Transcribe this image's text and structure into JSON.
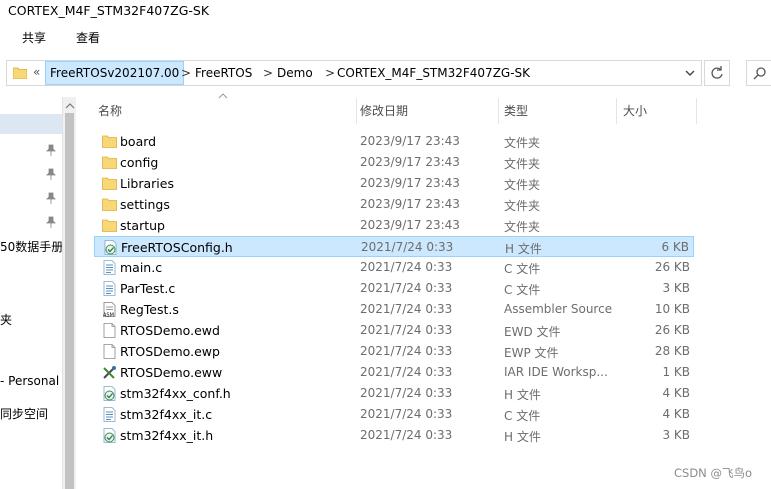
{
  "window": {
    "title": "CORTEX_M4F_STM32F407ZG-SK"
  },
  "ribbon": {
    "tabs": [
      "共享",
      "查看"
    ]
  },
  "address": {
    "overflow": "«",
    "crumbs": [
      "FreeRTOSv202107.00",
      "FreeRTOS",
      "Demo",
      "CORTEX_M4F_STM32F407ZG-SK"
    ],
    "separator": ">"
  },
  "nav": {
    "items": [
      "50数据手册",
      "夹",
      "- Personal",
      "同步空间"
    ]
  },
  "columns": {
    "name": "名称",
    "date": "修改日期",
    "type": "类型",
    "size": "大小"
  },
  "files": [
    {
      "name": "board",
      "date": "2023/9/17 23:43",
      "type": "文件夹",
      "size": "",
      "icon": "folder-icon"
    },
    {
      "name": "config",
      "date": "2023/9/17 23:43",
      "type": "文件夹",
      "size": "",
      "icon": "folder-icon"
    },
    {
      "name": "Libraries",
      "date": "2023/9/17 23:43",
      "type": "文件夹",
      "size": "",
      "icon": "folder-icon"
    },
    {
      "name": "settings",
      "date": "2023/9/17 23:43",
      "type": "文件夹",
      "size": "",
      "icon": "folder-icon"
    },
    {
      "name": "startup",
      "date": "2023/9/17 23:43",
      "type": "文件夹",
      "size": "",
      "icon": "folder-icon"
    },
    {
      "name": "FreeRTOSConfig.h",
      "date": "2021/7/24 0:33",
      "type": "H 文件",
      "size": "6 KB",
      "icon": "h-file-icon",
      "selected": true
    },
    {
      "name": "main.c",
      "date": "2021/7/24 0:33",
      "type": "C 文件",
      "size": "26 KB",
      "icon": "c-file-icon"
    },
    {
      "name": "ParTest.c",
      "date": "2021/7/24 0:33",
      "type": "C 文件",
      "size": "3 KB",
      "icon": "c-file-icon"
    },
    {
      "name": "RegTest.s",
      "date": "2021/7/24 0:33",
      "type": "Assembler Source",
      "size": "10 KB",
      "icon": "asm-file-icon"
    },
    {
      "name": "RTOSDemo.ewd",
      "date": "2021/7/24 0:33",
      "type": "EWD 文件",
      "size": "26 KB",
      "icon": "blank-file-icon"
    },
    {
      "name": "RTOSDemo.ewp",
      "date": "2021/7/24 0:33",
      "type": "EWP 文件",
      "size": "28 KB",
      "icon": "blank-file-icon"
    },
    {
      "name": "RTOSDemo.eww",
      "date": "2021/7/24 0:33",
      "type": "IAR IDE Worksp...",
      "size": "1 KB",
      "icon": "iar-workspace-icon"
    },
    {
      "name": "stm32f4xx_conf.h",
      "date": "2021/7/24 0:33",
      "type": "H 文件",
      "size": "4 KB",
      "icon": "h-file-icon"
    },
    {
      "name": "stm32f4xx_it.c",
      "date": "2021/7/24 0:33",
      "type": "C 文件",
      "size": "4 KB",
      "icon": "c-file-icon"
    },
    {
      "name": "stm32f4xx_it.h",
      "date": "2021/7/24 0:33",
      "type": "H 文件",
      "size": "3 KB",
      "icon": "h-file-icon"
    }
  ],
  "watermark": "CSDN @飞鸟o",
  "colors": {
    "selection": "#cce8ff",
    "selection_border": "#99d1ff",
    "folder": "#f8d775"
  }
}
